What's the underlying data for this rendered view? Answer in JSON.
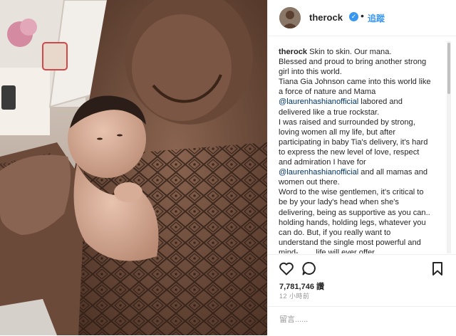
{
  "post": {
    "username": "therock",
    "verified_icon": "verified-badge-icon",
    "separator": "•",
    "follow_label": "追蹤",
    "caption_user": "therock",
    "caption_lines": [
      [
        {
          "t": "Skin to skin. Our mana."
        }
      ],
      [
        {
          "t": "Blessed and proud to bring another strong"
        }
      ],
      [
        {
          "t": "girl into this world."
        }
      ],
      [
        {
          "t": "Tiana Gia Johnson came into this world like"
        }
      ],
      [
        {
          "t": "a force of nature and Mama"
        }
      ],
      [
        {
          "t": "@laurenhashianofficial",
          "m": true
        },
        {
          "t": " labored and"
        }
      ],
      [
        {
          "t": "delivered like a true rockstar."
        }
      ],
      [
        {
          "t": "I was raised and surrounded by strong,"
        }
      ],
      [
        {
          "t": "loving women all my life, but after"
        }
      ],
      [
        {
          "t": "participating in baby Tia's delivery, it's hard"
        }
      ],
      [
        {
          "t": "to express the new level of love, respect"
        }
      ],
      [
        {
          "t": "and admiration I have for"
        }
      ],
      [
        {
          "t": "@laurenhashianofficial",
          "m": true
        },
        {
          "t": " and all mamas and"
        }
      ],
      [
        {
          "t": "women out there."
        }
      ],
      [
        {
          "t": "Word to the wise gentlemen, it's critical to"
        }
      ],
      [
        {
          "t": "be by your lady's head when she's"
        }
      ],
      [
        {
          "t": "delivering, being as supportive as you can.."
        }
      ],
      [
        {
          "t": "holding hands, holding legs, whatever you"
        }
      ],
      [
        {
          "t": "can do. But, if you really want to"
        }
      ],
      [
        {
          "t": "understand the single most powerful and"
        }
      ],
      [
        {
          "t": "mind-....... life will ever offer ........"
        }
      ]
    ],
    "likes": "7,781,746 讚",
    "time_ago": "12 小時前",
    "comment_placeholder": "留言......",
    "icons": {
      "like": "heart-icon",
      "comment": "comment-bubble-icon",
      "save": "bookmark-icon"
    }
  }
}
